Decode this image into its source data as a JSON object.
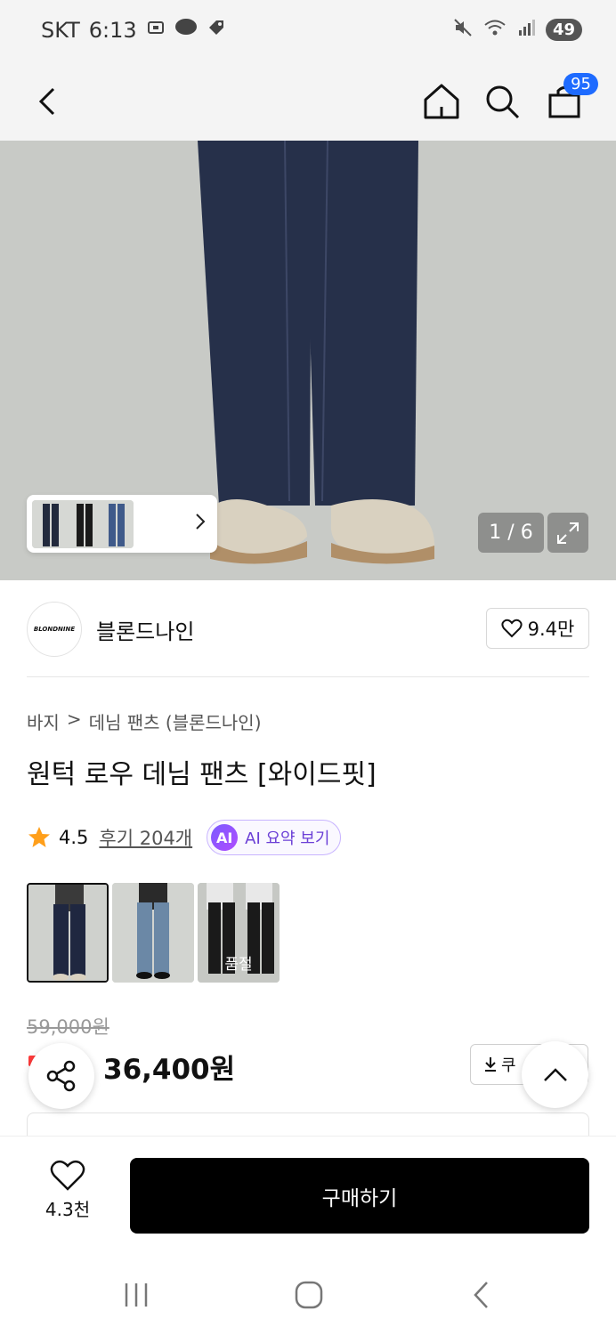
{
  "status": {
    "carrier": "SKT",
    "time": "6:13",
    "battery": "49"
  },
  "nav": {
    "cart_count": "95"
  },
  "gallery": {
    "counter": "1 / 6"
  },
  "brand": {
    "logo_text": "BLONDNINE",
    "name": "블론드나인",
    "likes": "9.4만"
  },
  "breadcrumb": {
    "category": "바지",
    "separator": ">",
    "subcategory": "데님 팬츠 (블론드나인)"
  },
  "product": {
    "title": "원턱 로우 데님 팬츠 [와이드핏]",
    "rating": "4.5",
    "reviews": "후기 204개",
    "ai_badge": "AI",
    "ai_summary": "AI 요약 보기",
    "soldout_label": "품절",
    "original_price": "59,000원",
    "sale_price": "36,400원",
    "coupon_label": "쿠"
  },
  "bottom": {
    "fav_count": "4.3천",
    "buy_label": "구매하기"
  },
  "colors": {
    "accent": "#1e6bff",
    "buy_button": "#000000",
    "ai_purple": "#6b3fd6",
    "star": "#ff9f1a"
  }
}
